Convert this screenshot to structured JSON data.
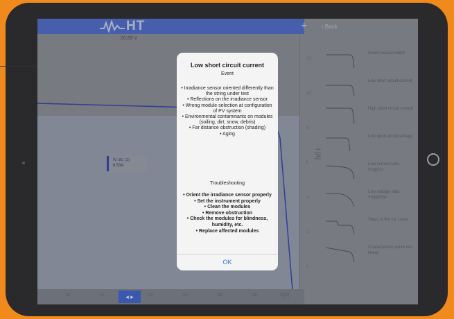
{
  "app": {
    "logo_text": "HT",
    "subtitle": "20,69 V"
  },
  "toolbar": {
    "add_label": "+",
    "back_label": "Back"
  },
  "chart": {
    "y_ticks": [
      "12",
      "10",
      "8",
      "6",
      "4",
      "2",
      "0"
    ],
    "y_label": "I [A]",
    "x_ticks": [
      "10",
      "15",
      "20",
      "25",
      "30",
      "35",
      "40"
    ],
    "x_unit": "V [V]",
    "legend_name": "IV stc (1)",
    "legend_value": "8.53A",
    "tab_label": "◂ ▸"
  },
  "reference_list": [
    {
      "label": "Good measurement"
    },
    {
      "label": "Low short circuit current"
    },
    {
      "label": "High short circuit current"
    },
    {
      "label": "Low open circuit voltage"
    },
    {
      "label": "Low current ratio Impp/Isc"
    },
    {
      "label": "Low voltage ratio Vmpp/Voc"
    },
    {
      "label": "Steps in the I-V curve"
    },
    {
      "label": "Characteristic curve not linear"
    }
  ],
  "dialog": {
    "title": "Low short circuit current",
    "event_heading": "Event",
    "causes": [
      "• Irradiance sensor oriented differently than the string under test",
      "• Reflections on the irradiance sensor",
      "• Wrong module selection at configuration of PV system",
      "• Environmental contaminants on modules (soiling, dirt, snow, debris)",
      "• Far distance obstruction (shading)",
      "• Aging"
    ],
    "troubleshooting_heading": "Troubleshooting",
    "actions": [
      "• Orient the irradiance sensor properly",
      "• Set the instrument properly",
      "• Clean the modules",
      "• Remove obstruction",
      "• Check the modules for blindness, humidity, etc.",
      "• Replace affected modules"
    ],
    "ok_label": "OK"
  },
  "colors": {
    "accent": "#3b62d6",
    "frame": "#f08a1c",
    "curve": "#2a3fb0"
  }
}
